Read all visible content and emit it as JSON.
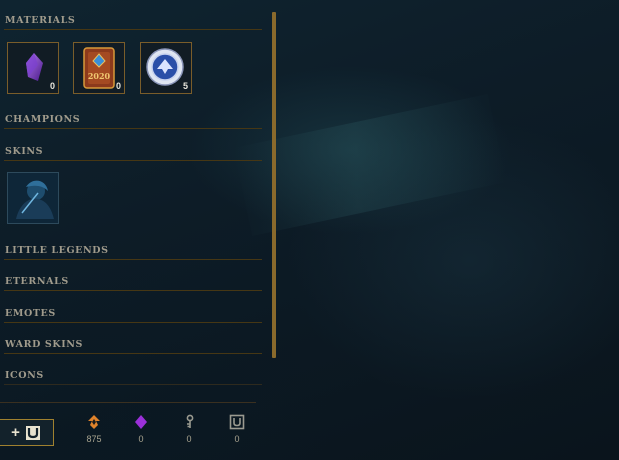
{
  "sections": {
    "materials": "MATERIALS",
    "champions": "CHAMPIONS",
    "skins": "SKINS",
    "little_legends": "LITTLE LEGENDS",
    "eternals": "ETERNALS",
    "emotes": "EMOTES",
    "ward_skins": "WARD SKINS",
    "icons": "ICONS"
  },
  "materials": [
    {
      "icon": "purple-gem-icon",
      "count": "0"
    },
    {
      "icon": "2020-capsule-icon",
      "text": "2020",
      "count": "0"
    },
    {
      "icon": "blue-token-icon",
      "count": "5"
    }
  ],
  "skins": [
    {
      "icon": "skin-shard-icon"
    }
  ],
  "footer": {
    "craft_button": {
      "plus": "+"
    },
    "currencies": [
      {
        "icon": "orange-essence-icon",
        "value": "875",
        "color": "#e0832b"
      },
      {
        "icon": "mythic-essence-icon",
        "value": "0",
        "color": "#9b30d9"
      },
      {
        "icon": "key-icon",
        "value": "0",
        "color": "#9a9a90"
      },
      {
        "icon": "chest-icon",
        "value": "0",
        "color": "#9a9a90"
      }
    ]
  }
}
